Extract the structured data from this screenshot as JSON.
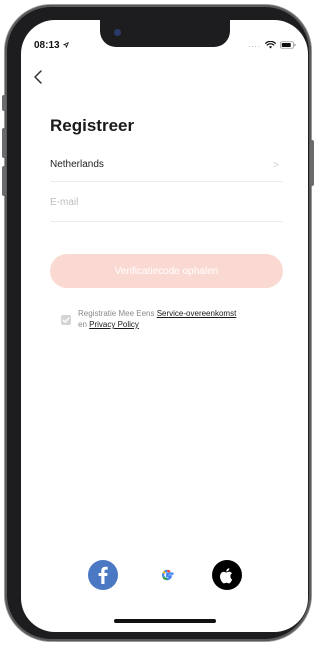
{
  "status_bar": {
    "time": "08:13",
    "signal_dots": "....",
    "icons": [
      "location-arrow-icon",
      "wifi-icon",
      "battery-icon"
    ]
  },
  "nav": {
    "back_icon": "chevron-left-icon"
  },
  "page": {
    "title": "Registreer"
  },
  "form": {
    "country": "Netherlands",
    "email_placeholder": "E-mail",
    "email_value": "",
    "verify_button_label": "Verificatiecode ophalen"
  },
  "agreement": {
    "prefix": "Registratie Mee Eens ",
    "service_link": "Service-overeenkomst",
    "middle": " en ",
    "privacy_link": "Privacy Policy",
    "checked": true
  },
  "social_login": [
    {
      "name": "facebook",
      "icon": "facebook-icon"
    },
    {
      "name": "google",
      "icon": "google-icon"
    },
    {
      "name": "apple",
      "icon": "apple-icon"
    }
  ],
  "colors": {
    "accent": "#fbd9d3",
    "facebook": "#4a78c2",
    "apple": "#000000",
    "google_blue": "#4285f4",
    "google_red": "#ea4335",
    "google_yellow": "#fbbc05",
    "google_green": "#34a853"
  }
}
